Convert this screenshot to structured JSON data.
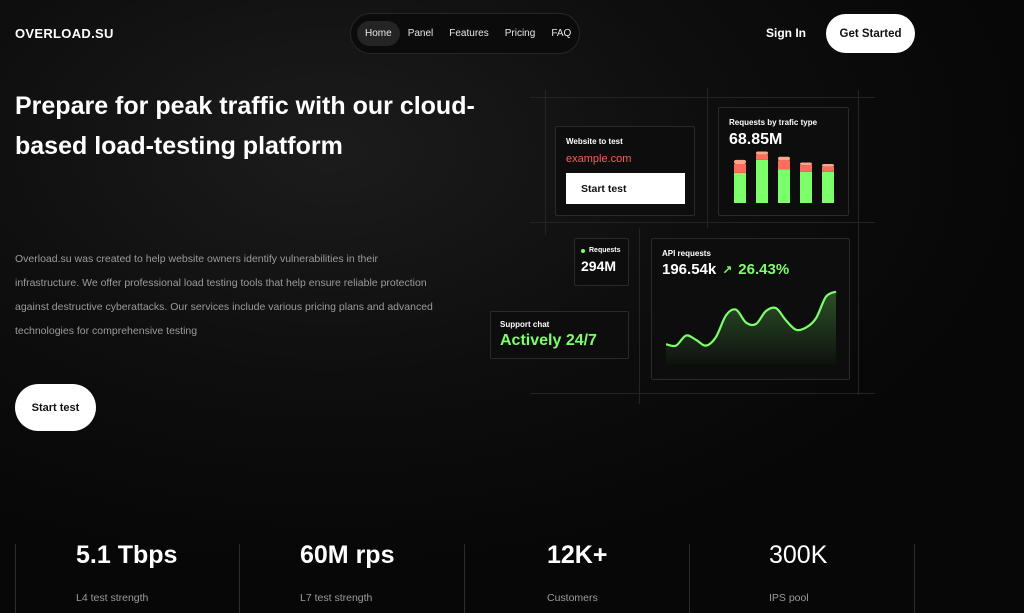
{
  "header": {
    "logo": "OVERLOAD.SU",
    "nav": [
      {
        "label": "Home",
        "active": true
      },
      {
        "label": "Panel",
        "active": false
      },
      {
        "label": "Features",
        "active": false
      },
      {
        "label": "Pricing",
        "active": false
      },
      {
        "label": "FAQ",
        "active": false
      }
    ],
    "sign_in": "Sign In",
    "get_started": "Get Started"
  },
  "hero": {
    "title": "Prepare for peak traffic with our cloud-based load-testing platform",
    "description": "Overload.su was created to help website owners identify vulnerabilities in their infrastructure. We offer professional load testing tools that help ensure reliable protection against destructive cyberattacks. Our services include various pricing plans and advanced technologies for comprehensive testing",
    "button": "Start test"
  },
  "dashboard": {
    "website_card": {
      "label": "Website to test",
      "url": "example.com",
      "button": "Start test"
    },
    "traffic_card": {
      "label": "Requests by trafic type",
      "value": "68.85M",
      "bars": [
        {
          "green": 0.58,
          "red": 0.17,
          "salmon": 0.08
        },
        {
          "green": 0.83,
          "red": 0.1,
          "salmon": 0.06
        },
        {
          "green": 0.65,
          "red": 0.17,
          "salmon": 0.07
        },
        {
          "green": 0.6,
          "red": 0.13,
          "salmon": 0.05
        },
        {
          "green": 0.6,
          "red": 0.1,
          "salmon": 0.05
        }
      ]
    },
    "requests_card": {
      "label": "Requests",
      "value": "294M"
    },
    "support_card": {
      "label": "Support chat",
      "value": "Actively 24/7"
    },
    "api_card": {
      "label": "API requests",
      "value": "196.54k",
      "change": "26.43%",
      "series": [
        0.22,
        0.2,
        0.34,
        0.28,
        0.2,
        0.32,
        0.62,
        0.7,
        0.52,
        0.5,
        0.68,
        0.72,
        0.55,
        0.42,
        0.45,
        0.58,
        0.88,
        0.95
      ]
    },
    "colors": {
      "green": "#7cff6b",
      "red": "#ff6b5c",
      "salmon": "#f7a78a"
    }
  },
  "stats": [
    {
      "value": "5.1 Tbps",
      "label": "L4 test strength"
    },
    {
      "value": "60M rps",
      "label": "L7 test strength"
    },
    {
      "value": "12K+",
      "label": "Customers"
    },
    {
      "value": "300K",
      "label": "IPS pool"
    }
  ]
}
